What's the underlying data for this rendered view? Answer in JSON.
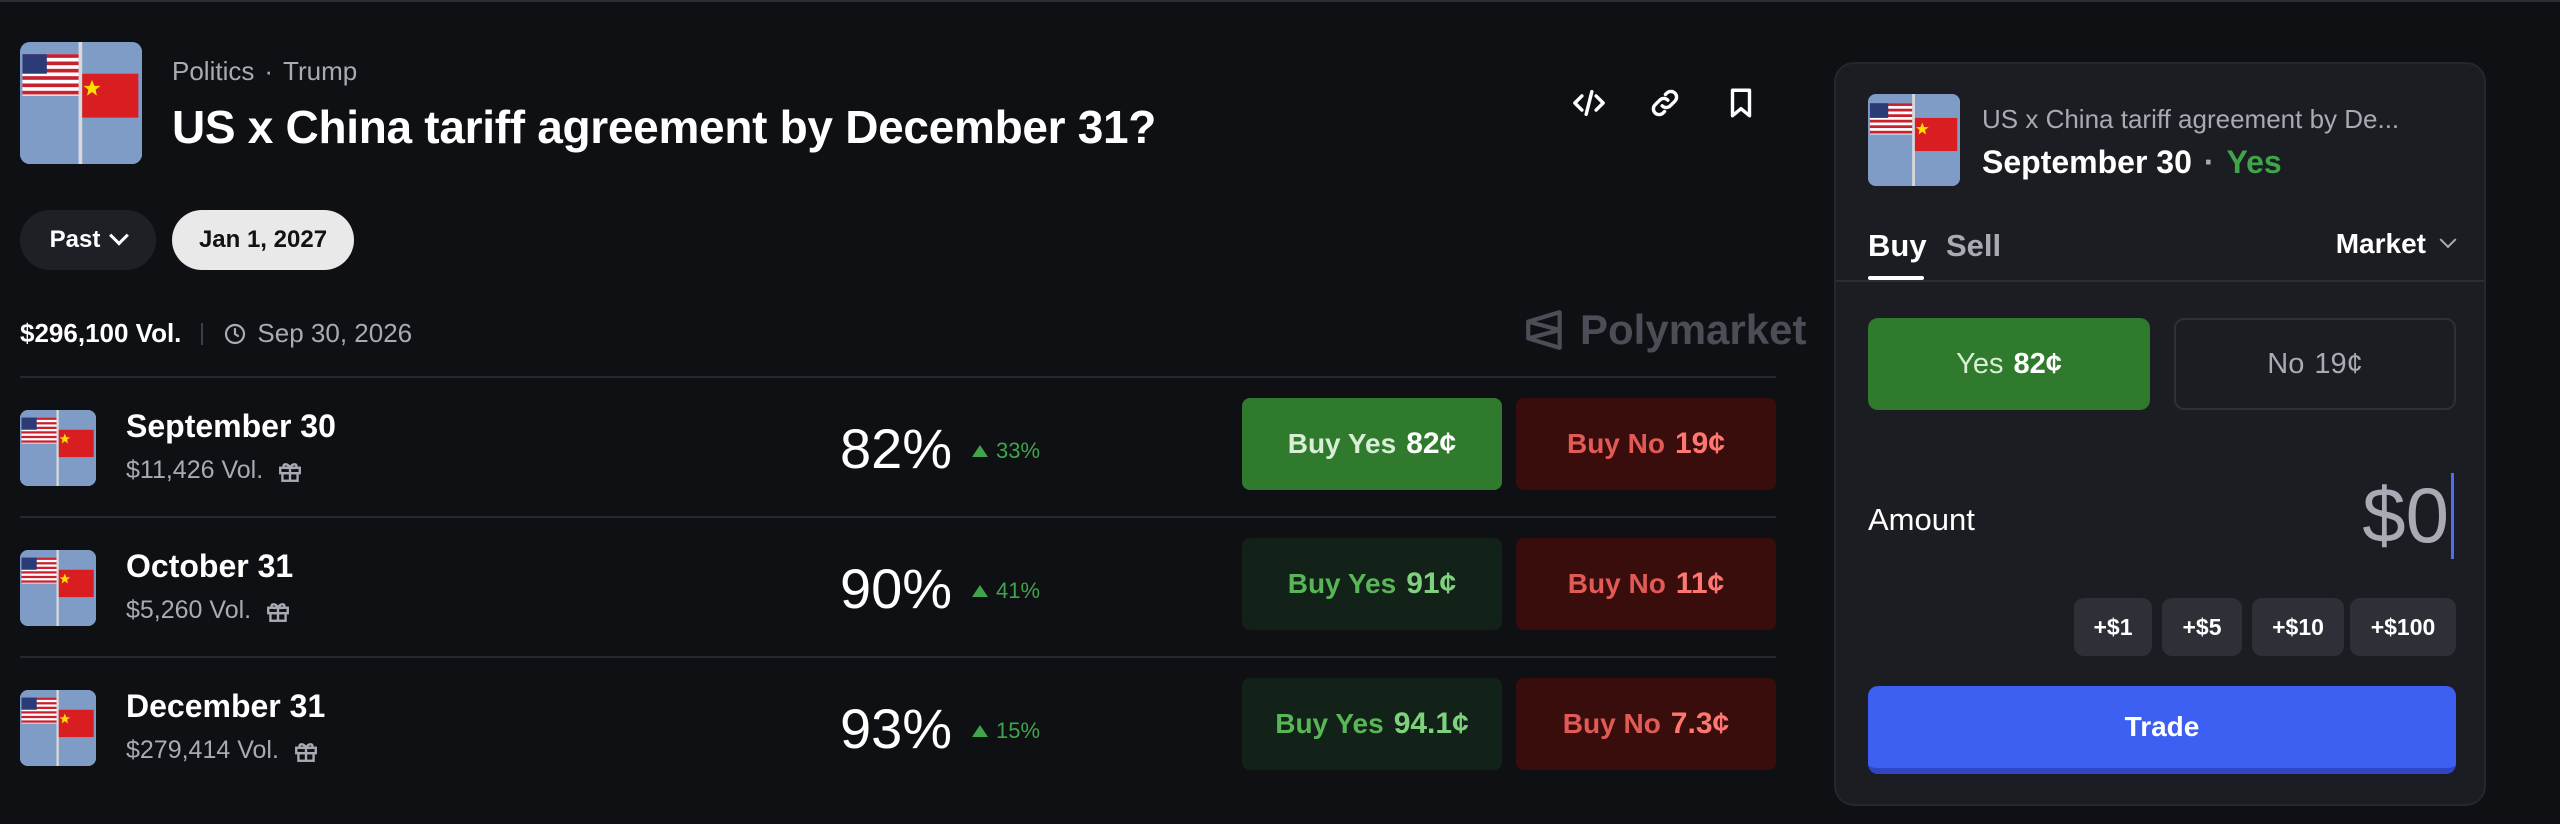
{
  "header": {
    "category": "Politics",
    "tag": "Trump",
    "separator": "·",
    "title": "US x China tariff agreement by December 31?",
    "icons": [
      "embed-code-icon",
      "link-icon",
      "bookmark-icon"
    ]
  },
  "filters": {
    "past_label": "Past",
    "date_label": "Jan 1, 2027"
  },
  "summary": {
    "total_volume": "$296,100 Vol.",
    "end_date": "Sep 30, 2026"
  },
  "brand": {
    "name": "Polymarket"
  },
  "outcomes": [
    {
      "title": "September 30",
      "volume": "$11,426 Vol.",
      "percent": "82%",
      "change": "33%",
      "yes_label": "Buy Yes",
      "yes_price": "82¢",
      "no_label": "Buy No",
      "no_price": "19¢",
      "selected": true
    },
    {
      "title": "October 31",
      "volume": "$5,260 Vol.",
      "percent": "90%",
      "change": "41%",
      "yes_label": "Buy Yes",
      "yes_price": "91¢",
      "no_label": "Buy No",
      "no_price": "11¢",
      "selected": false
    },
    {
      "title": "December 31",
      "volume": "$279,414 Vol.",
      "percent": "93%",
      "change": "15%",
      "yes_label": "Buy Yes",
      "yes_price": "94.1¢",
      "no_label": "Buy No",
      "no_price": "7.3¢",
      "selected": false
    }
  ],
  "panel": {
    "market": "US x China tariff agreement by De...",
    "outcome": "September 30",
    "dot": "·",
    "side": "Yes",
    "tab_buy": "Buy",
    "tab_sell": "Sell",
    "order_type": "Market",
    "yes_label": "Yes",
    "yes_price": "82¢",
    "no_label": "No",
    "no_price": "19¢",
    "amount_label": "Amount",
    "amount_value": "$0",
    "quick_amounts": [
      "+$1",
      "+$5",
      "+$10",
      "+$100"
    ],
    "trade_label": "Trade"
  },
  "colors": {
    "background": "#0f1013",
    "panel": "#1b1d22",
    "yes_green": "#2f7a2c",
    "no_red": "#3a0d0d",
    "trade_blue": "#3d60f2",
    "positive_change": "#3fa44a"
  }
}
